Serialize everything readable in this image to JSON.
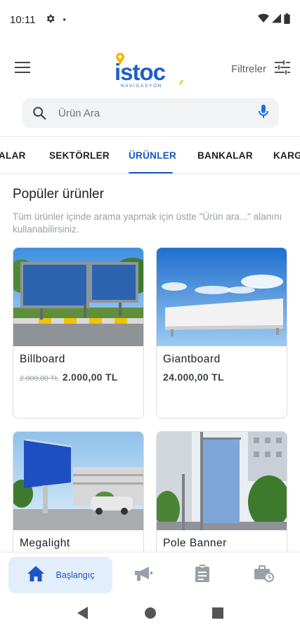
{
  "status_bar": {
    "time": "10:11",
    "dot": "•"
  },
  "header": {
    "logo_text": "istoc",
    "logo_subtext": "NAVIGASYON",
    "filter_label": "Filtreler"
  },
  "search": {
    "placeholder": "Ürün Ara"
  },
  "tabs": [
    {
      "label": "ALAR"
    },
    {
      "label": "SEKTÖRLER"
    },
    {
      "label": "ÜRÜNLER",
      "active": true
    },
    {
      "label": "BANKALAR"
    },
    {
      "label": "KARG"
    }
  ],
  "section": {
    "title": "Popüler ürünler",
    "description": "Tüm ürünler içinde arama yapmak için üstte \"Ürün ara...\" alanını kullanabilirsiniz."
  },
  "products": [
    {
      "name": "Billboard",
      "old_price": "2.000,00 TL",
      "price": "2.000,00 TL"
    },
    {
      "name": "Giantboard",
      "price": "24.000,00 TL"
    },
    {
      "name": "Megalight"
    },
    {
      "name": "Pole Banner"
    }
  ],
  "bottom_nav": {
    "items": [
      {
        "label": "Başlangıç",
        "icon": "home-icon",
        "active": true
      },
      {
        "icon": "megaphone-icon"
      },
      {
        "icon": "clipboard-icon"
      },
      {
        "icon": "briefcase-clock-icon"
      }
    ]
  },
  "colors": {
    "accent": "#1a56c9",
    "logo_blue": "#1f5fc4",
    "logo_yellow": "#f5b800"
  }
}
